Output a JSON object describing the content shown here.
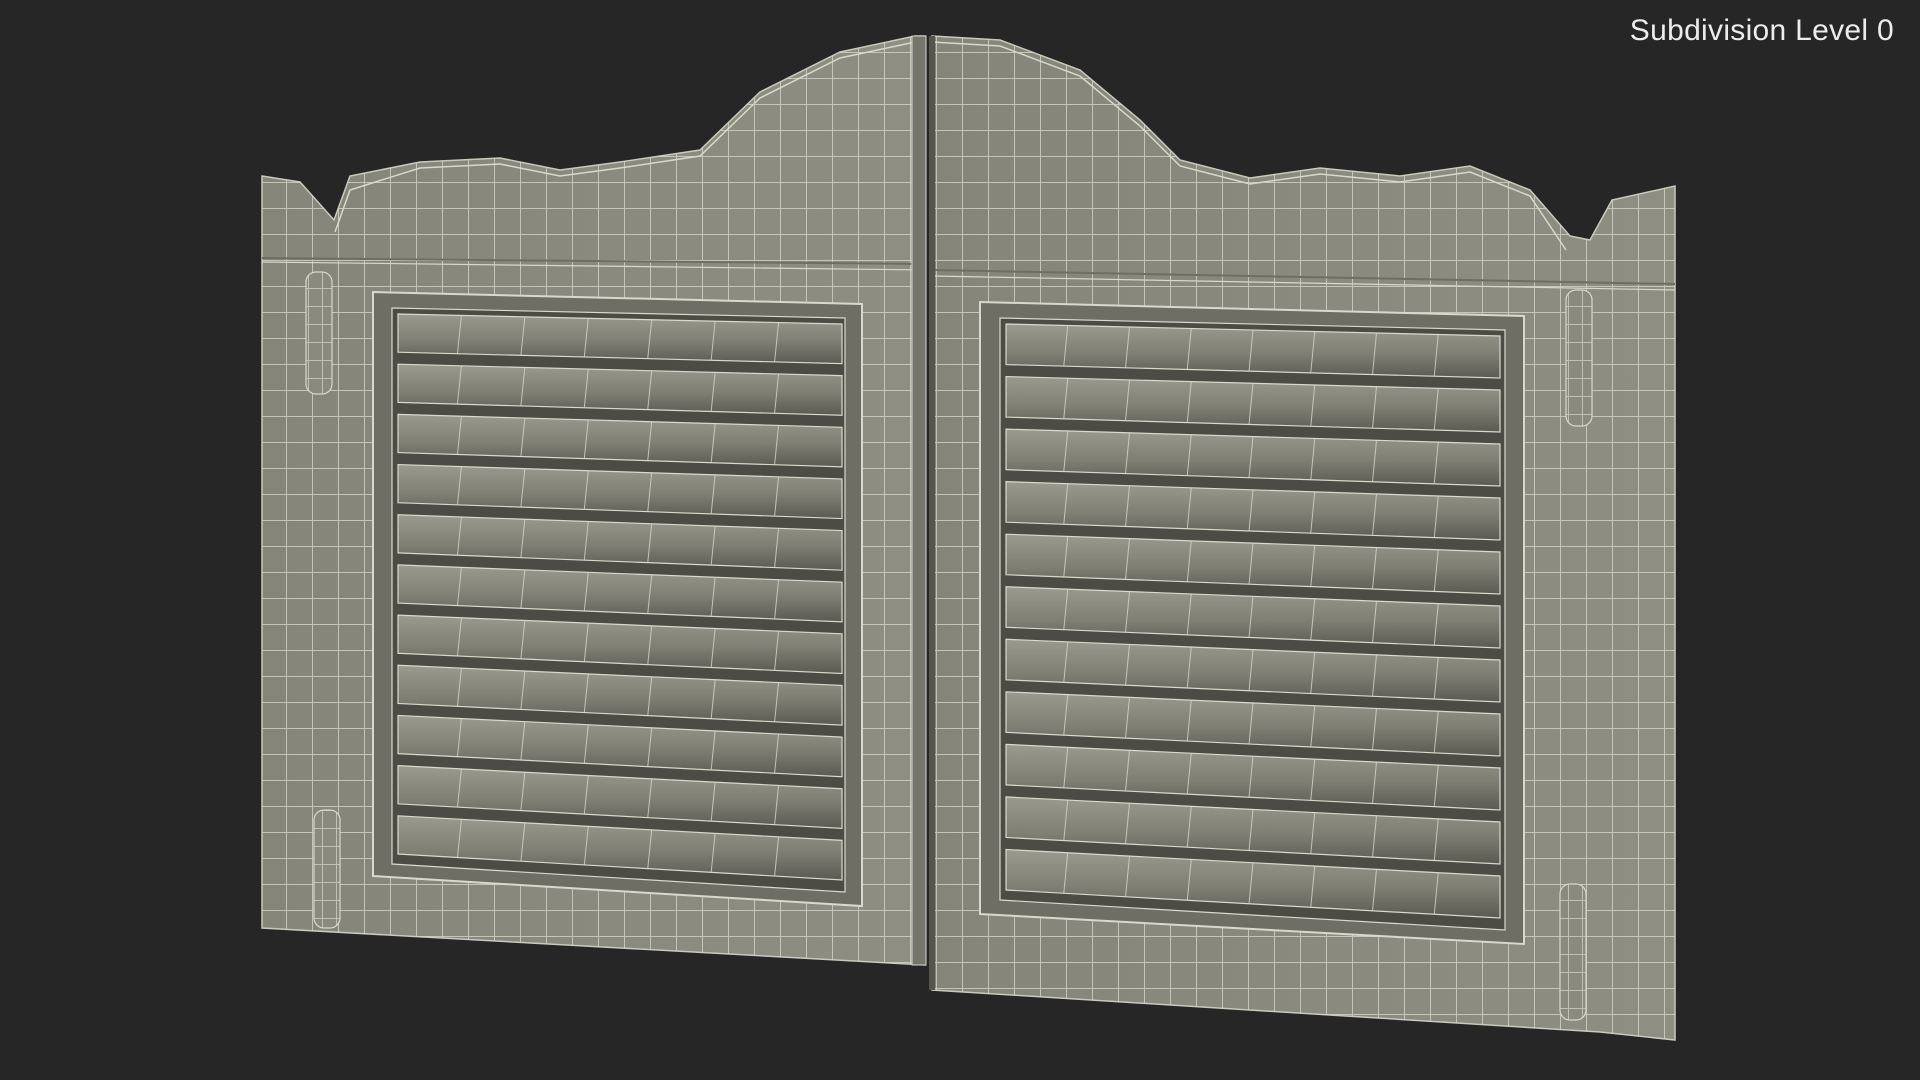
{
  "viewport": {
    "label": "Subdivision Level 0",
    "background_color": "#262626"
  },
  "model": {
    "subject": "saloon-swinging-doors",
    "render_mode": "wireframe-on-shaded",
    "surface_color": "#8a8a7e",
    "wire_color": "#d8d8cc",
    "door_leaves": 2,
    "louver_slats_per_leaf": 11,
    "hinges_per_leaf": 2
  }
}
